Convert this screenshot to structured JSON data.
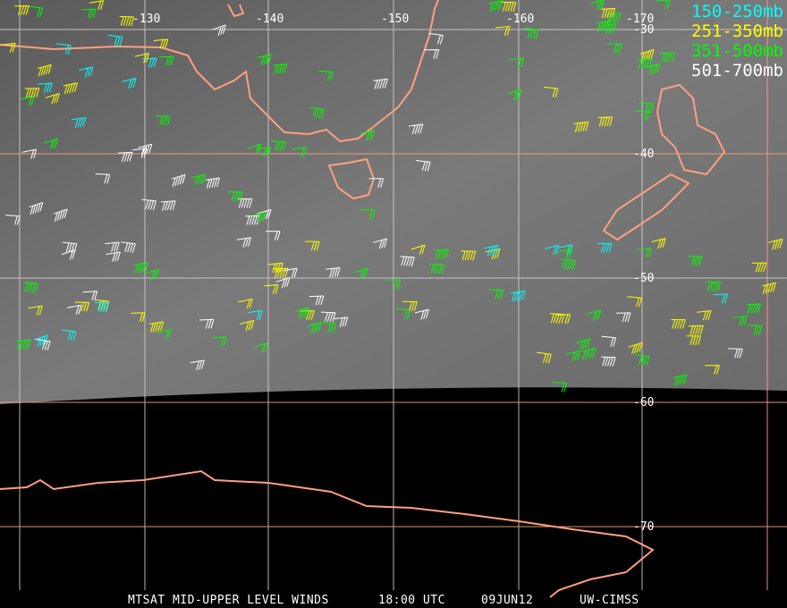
{
  "title": "MTSAT MID-UPPER LEVEL WINDS",
  "time": "18:00 UTC",
  "date": "09JUN12",
  "credit": "UW-CIMSS",
  "legend": [
    {
      "label": "150-250mb",
      "color": "#00ffff"
    },
    {
      "label": "251-350mb",
      "color": "#ffff00"
    },
    {
      "label": "351-500mb",
      "color": "#00ff00"
    },
    {
      "label": "501-700mb",
      "color": "#ffffff"
    }
  ],
  "longitude_labels": [
    "-130",
    "-140",
    "-150",
    "-160",
    "-170"
  ],
  "latitude_labels": [
    "-30",
    "-40",
    "-50",
    "-60",
    "-70"
  ],
  "colors": {
    "grid": "#ff9f7f",
    "coast": "#ff9f7f",
    "space": "#000000"
  }
}
